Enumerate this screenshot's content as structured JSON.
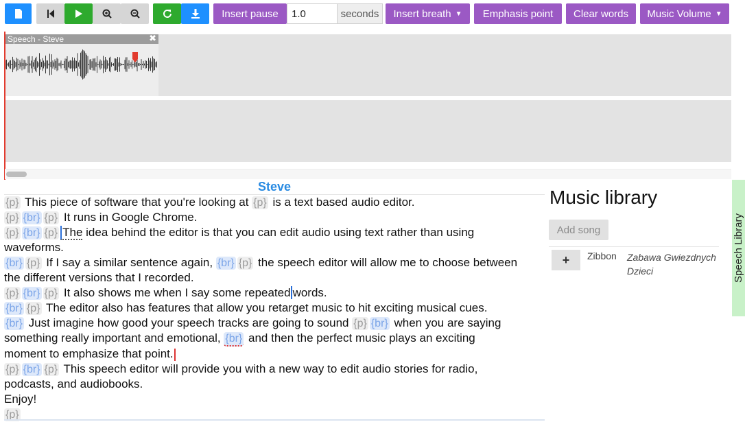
{
  "toolbar": {
    "insert_pause": "Insert pause",
    "pause_value": "1.0",
    "seconds": "seconds",
    "insert_breath": "Insert breath",
    "emphasis_point": "Emphasis point",
    "clear_words": "Clear words",
    "music_volume": "Music Volume"
  },
  "timeline": {
    "clip_title": "Speech - Steve"
  },
  "editor": {
    "title": "Steve",
    "tags": {
      "p": "{p}",
      "br": "{br}"
    },
    "text": {
      "l1a": "This piece of software that you're looking at",
      "l1b": "is a text based audio editor.",
      "l2": "It runs in Google Chrome.",
      "l3a": "The",
      "l3b": "idea behind the editor is that you can edit audio using text rather than using",
      "l4": "waveforms.",
      "l5a": "If I say a similar sentence again,",
      "l5b": "the speech editor will allow me to choose between",
      "l6": "the different versions that I recorded.",
      "l7a": "It also shows me when I say some repeated",
      "l7b": "words.",
      "l8": "The editor also has features that allow you retarget music to hit exciting musical cues.",
      "l9a": "Just imagine how good your speech tracks are going to sound",
      "l9b": "when you are saying",
      "l10a": "something really important and emotional,",
      "l10b": "and then the perfect music plays an exciting",
      "l11": "moment to emphasize that point.",
      "l12": "This speech editor will provide you with a new way to edit audio stories for radio,",
      "l13": "podcasts, and audiobooks.",
      "l14": "Enjoy!"
    }
  },
  "library": {
    "title": "Music library",
    "add_song": "Add song",
    "songs": [
      {
        "artist": "Zibbon",
        "title": "Zabawa Gwiezdnych Dzieci"
      }
    ]
  },
  "side_tab": "Speech Library",
  "colors": {
    "accent_purple": "#9b59c4",
    "green": "#2eaa2e",
    "blue": "#1e90ff",
    "editor_title": "#2a8be2",
    "playhead": "#e23b2e"
  },
  "icons": [
    "file-icon",
    "skip-back-icon",
    "play-icon",
    "zoom-in-icon",
    "zoom-out-icon",
    "refresh-icon",
    "download-icon",
    "close-icon",
    "plus-icon"
  ]
}
